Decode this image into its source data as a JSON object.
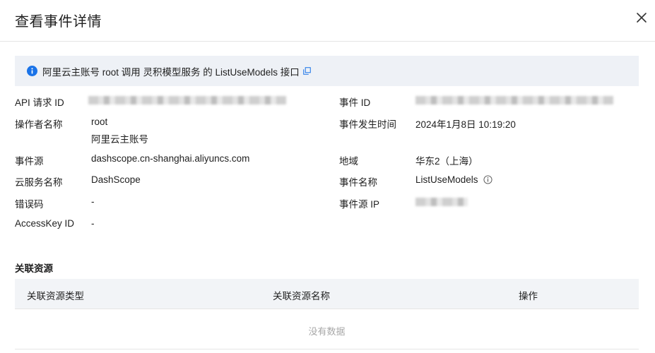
{
  "dialog": {
    "title": "查看事件详情"
  },
  "banner": {
    "text": "阿里云主账号 root 调用 灵积模型服务 的 ListUseModels 接口"
  },
  "details": {
    "api_request_id_label": "API 请求 ID",
    "api_request_id_value": "",
    "event_id_label": "事件 ID",
    "event_id_value": "",
    "operator_label": "操作者名称",
    "operator_value_1": "root",
    "operator_value_2": "阿里云主账号",
    "event_time_label": "事件发生时间",
    "event_time_value": "2024年1月8日 10:19:20",
    "event_source_label": "事件源",
    "event_source_value": "dashscope.cn-shanghai.aliyuncs.com",
    "region_label": "地域",
    "region_value": "华东2（上海）",
    "cloud_service_label": "云服务名称",
    "cloud_service_value": "DashScope",
    "event_name_label": "事件名称",
    "event_name_value": "ListUseModels",
    "error_code_label": "错误码",
    "error_code_value": "-",
    "event_source_ip_label": "事件源 IP",
    "event_source_ip_value": "",
    "accesskey_label": "AccessKey ID",
    "accesskey_value": "-"
  },
  "related": {
    "title": "关联资源",
    "columns": [
      "关联资源类型",
      "关联资源名称",
      "操作"
    ],
    "empty_text": "没有数据"
  },
  "colors": {
    "banner_bg": "#eef1f6",
    "info_blue": "#1a73e8",
    "table_header_bg": "#f2f4f7"
  },
  "icons": {
    "close": "close-icon",
    "info": "info-icon",
    "external_link": "external-link-icon",
    "info_circle": "info-circle-icon"
  }
}
